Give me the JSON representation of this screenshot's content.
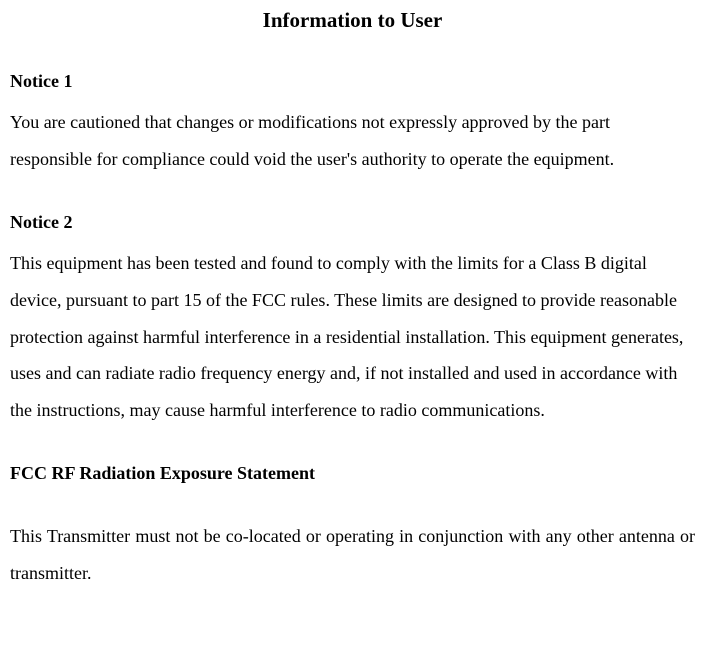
{
  "document": {
    "title": "Information to User",
    "sections": [
      {
        "heading": "Notice 1",
        "body": "You are cautioned that changes or modifications not expressly approved by the part responsible for compliance could void the user's authority to operate the equipment."
      },
      {
        "heading": "Notice 2",
        "body": "This equipment has been tested and found to comply with the limits for a Class B digital device, pursuant to part 15 of the FCC rules. These limits are designed to provide reasonable protection against harmful interference in a residential installation. This equipment generates, uses and can radiate radio frequency energy and, if not installed and used in accordance with the instructions, may cause harmful interference to radio communications."
      },
      {
        "heading": "FCC RF Radiation Exposure Statement",
        "body": "This Transmitter must not be co-located or operating in conjunction with any other antenna or transmitter."
      }
    ]
  }
}
